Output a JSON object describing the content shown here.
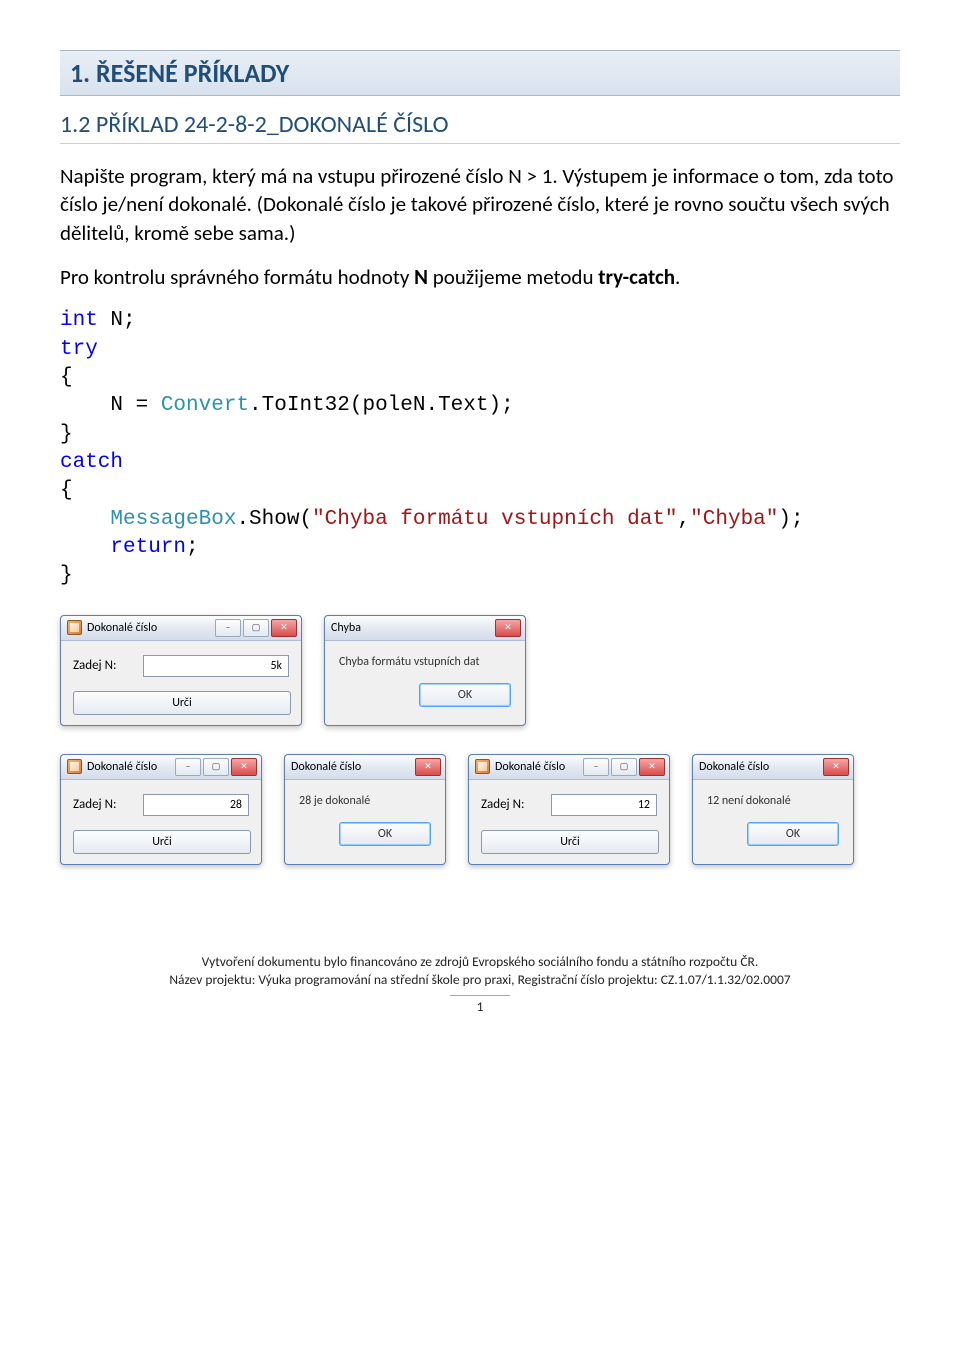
{
  "heading1": "1. ŘEŠENÉ PŘÍKLADY",
  "heading2": "1.2 PŘÍKLAD 24-2-8-2_DOKONALÉ ČÍSLO",
  "para1": "Napište program, který má na vstupu přirozené číslo N > 1. Výstupem je informace o tom, zda toto číslo je/není dokonalé. (Dokonalé číslo je takové přirozené číslo, které je rovno součtu všech svých dělitelů, kromě sebe sama.)",
  "para2_pre": "Pro kontrolu správného formátu hodnoty ",
  "para2_mid": "N",
  "para2_post": " použijeme metodu ",
  "para2_bold": "try-catch",
  "para2_end": ".",
  "code": {
    "l1a": "int",
    "l1b": " N;",
    "l2": "try",
    "l3": "{",
    "l4a": "    N = ",
    "l4b": "Convert",
    "l4c": ".ToInt32(poleN.Text);",
    "l5": "}",
    "l6": "catch",
    "l7": "{",
    "l8a": "    ",
    "l8b": "MessageBox",
    "l8c": ".Show(",
    "l8d": "\"Chyba formátu vstupních dat\"",
    "l8e": ",",
    "l8f": "\"Chyba\"",
    "l8g": ");",
    "l9a": "    ",
    "l9b": "return",
    "l9c": ";",
    "l10": "}"
  },
  "win_app_title": "Dokonalé číslo",
  "label_zadej": "Zadej N:",
  "btn_urci": "Urči",
  "dlg_chyba_title": "Chyba",
  "dlg_chyba_msg": "Chyba formátu vstupních dat",
  "btn_ok": "OK",
  "val_5k": "5k",
  "val_28": "28",
  "val_12": "12",
  "dlg2_title": "Dokonalé číslo",
  "dlg2_msg28": "28 je dokonalé",
  "dlg2_msg12": "12 není dokonalé",
  "footer1": "Vytvoření dokumentu bylo financováno ze zdrojů Evropského sociálního fondu a státního rozpočtu ČR.",
  "footer2": "Název projektu: Výuka programování na střední škole pro praxi, Registrační číslo projektu: CZ.1.07/1.1.32/02.0007",
  "page_number": "1"
}
